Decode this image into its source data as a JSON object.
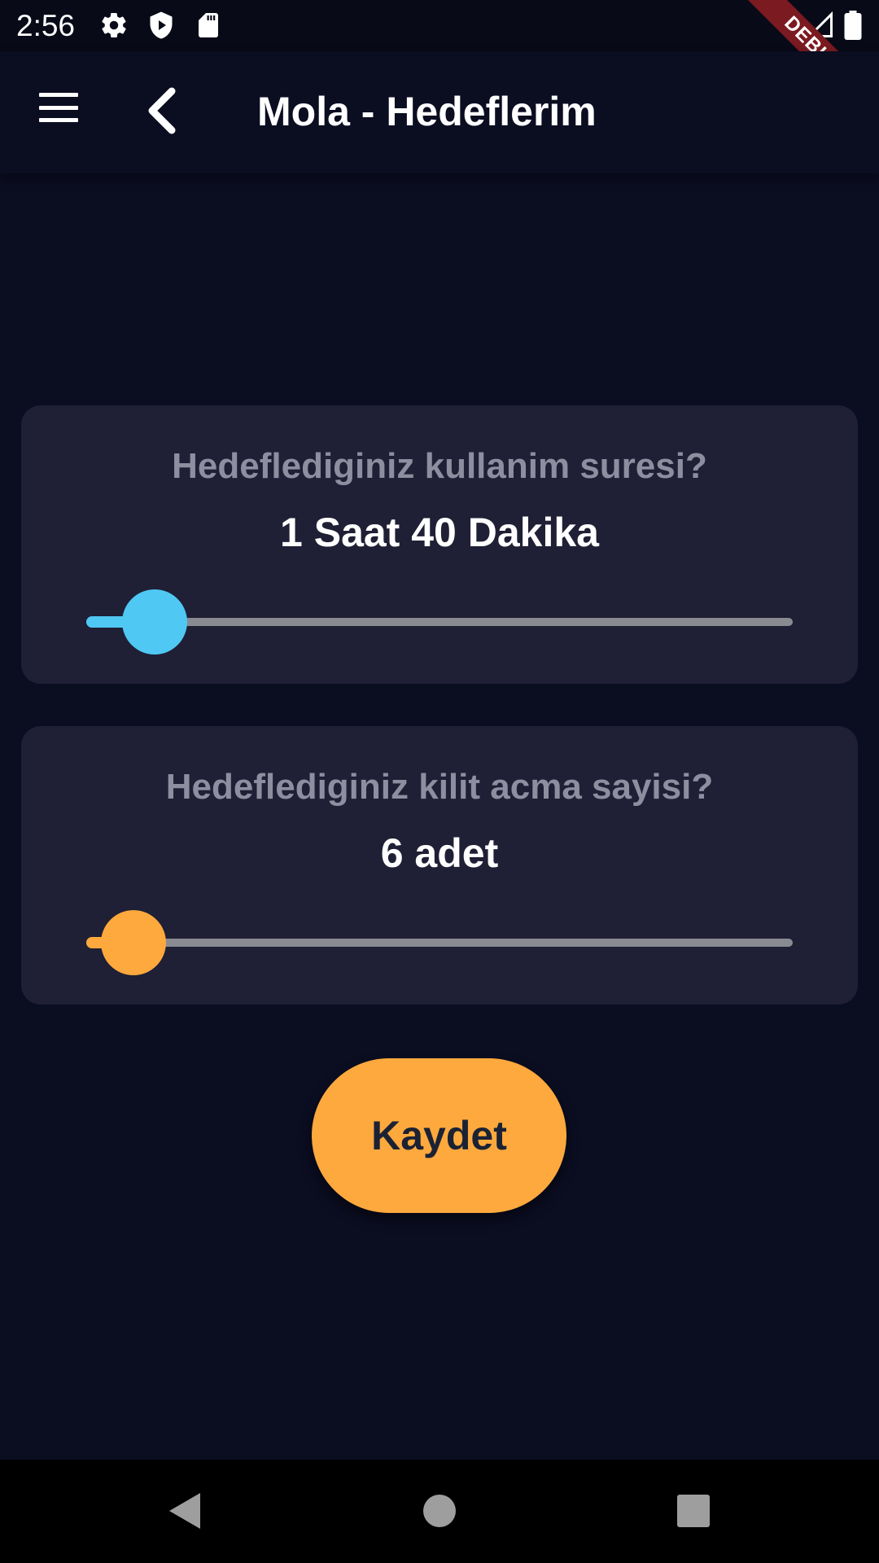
{
  "status_bar": {
    "time": "2:56",
    "icons_left": [
      "gear-icon",
      "play-protect-icon",
      "sd-card-icon"
    ],
    "icons_right": [
      "wifi-icon",
      "signal-icon",
      "battery-icon"
    ]
  },
  "debug_banner": "DEBUG",
  "app_bar": {
    "title": "Mola - Hedeflerim",
    "menu_icon": "hamburger-menu-icon",
    "back_icon": "chevron-left-icon"
  },
  "usage_card": {
    "question": "Hedeflediginiz kullanim suresi?",
    "value": "1 Saat 40 Dakika",
    "slider_fraction": 0.097,
    "accent": "#4fc8f3"
  },
  "unlock_card": {
    "question": "Hedeflediginiz kilit acma sayisi?",
    "value": "6 adet",
    "slider_fraction": 0.067,
    "accent": "#fea93d"
  },
  "save_button": {
    "label": "Kaydet",
    "color": "#fea93d"
  },
  "nav_bar": {
    "icons": [
      "back-triangle-icon",
      "home-circle-icon",
      "recents-square-icon"
    ]
  },
  "colors": {
    "background": "#0b0d21",
    "card": "#1f1f35",
    "track": "#8a8a92"
  }
}
